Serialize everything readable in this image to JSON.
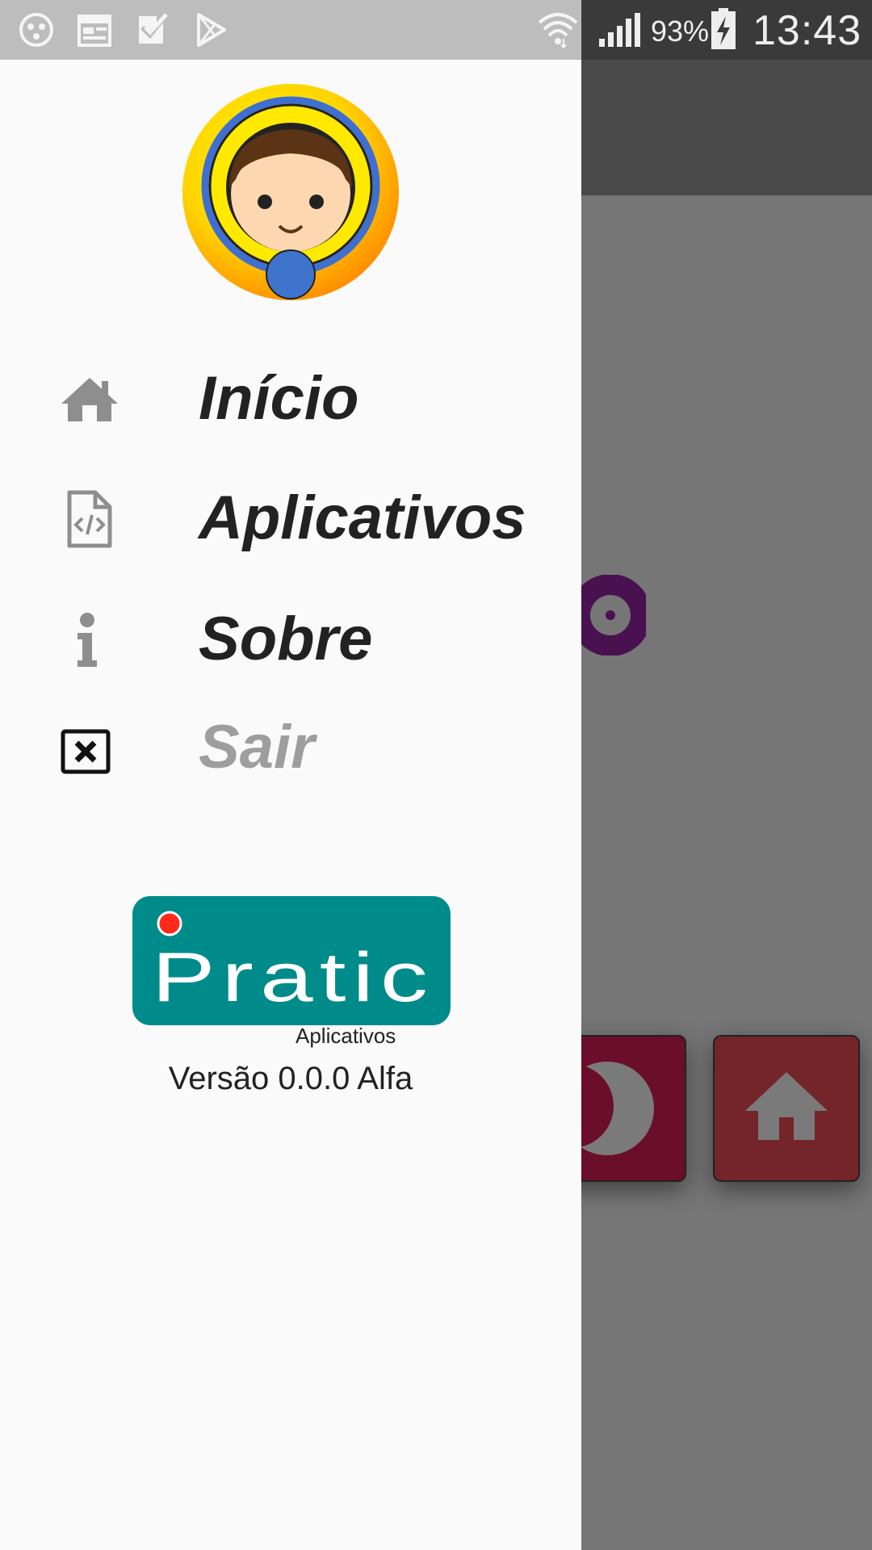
{
  "status_bar": {
    "battery_percent": "93%",
    "time": "13:43",
    "icons": [
      "cat-notification-icon",
      "calendar-icon",
      "tasks-check-icon",
      "play-store-icon",
      "wifi-icon",
      "signal-icon",
      "battery-charging-icon"
    ]
  },
  "drawer": {
    "avatar_icon": "saint-avatar-icon",
    "menu": [
      {
        "label": "Início",
        "icon": "home-icon",
        "enabled": true
      },
      {
        "label": "Aplicativos",
        "icon": "code-file-icon",
        "enabled": true
      },
      {
        "label": "Sobre",
        "icon": "info-icon",
        "enabled": true
      },
      {
        "label": "Sair",
        "icon": "close-box-icon",
        "enabled": false
      }
    ],
    "logo": {
      "name": "Pratic",
      "subtitle": "Aplicativos"
    },
    "version": "Versão 0.0.0 Alfa"
  },
  "colors": {
    "drawer_bg": "#fafafa",
    "scrim": "#767676",
    "logo_teal": "#008b8b",
    "tile_moon": "#6a0e2c",
    "tile_home": "#73252a",
    "disabled_text": "#9e9e9e"
  }
}
